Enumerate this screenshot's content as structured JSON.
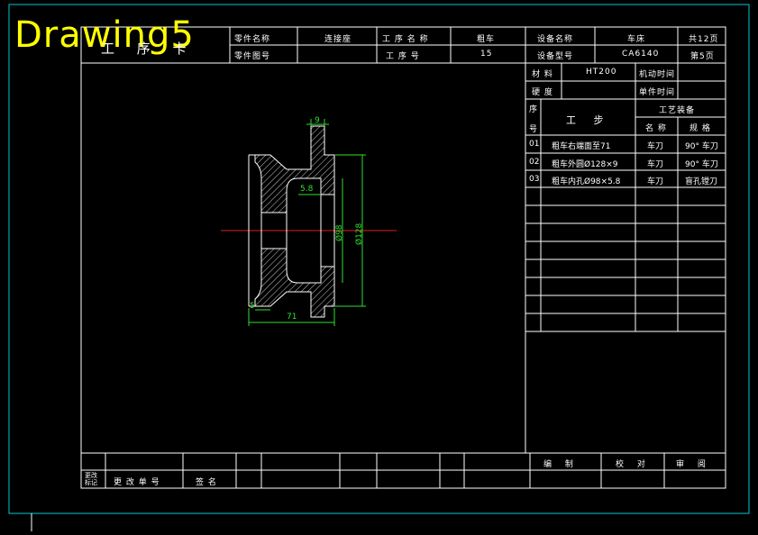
{
  "drawing_title": "Drawing5",
  "header": {
    "process_card_label": "工 序 卡",
    "part_name_label": "零件名称",
    "part_name": "连接座",
    "part_number_label": "零件图号",
    "process_name_label": "工 序 名 称",
    "process_name": "粗车",
    "process_no_label": "工 序 号",
    "process_no": "15",
    "equipment_name_label": "设备名称",
    "equipment_name": "车床",
    "equipment_model_label": "设备型号",
    "equipment_model": "CA6140",
    "total_pages": "共12页",
    "page_no": "第5页"
  },
  "material": {
    "material_label": "材 料",
    "material_value": "HT200",
    "hardness_label": "硬 度",
    "basic_time_label": "机动时间",
    "unit_time_label": "单件时间"
  },
  "steps_table": {
    "seq_label_top": "序",
    "seq_label_bottom": "号",
    "step_label": "工 步",
    "equipment_label": "工艺装备",
    "name_label": "名 称",
    "spec_label": "规 格",
    "rows": [
      {
        "no": "01",
        "step": "粗车右端面至71",
        "tool": "车刀",
        "spec": "90° 车刀"
      },
      {
        "no": "02",
        "step": "粗车外圆Ø128×9",
        "tool": "车刀",
        "spec": "90° 车刀"
      },
      {
        "no": "03",
        "step": "粗车内孔Ø98×5.8",
        "tool": "车刀",
        "spec": "盲孔镗刀"
      }
    ]
  },
  "footer": {
    "change_mark_label": "更改标记",
    "change_doc_label": "更 改 单 号",
    "signature_label": "签 名",
    "compiled_label": "编 制",
    "checked_label": "校 对",
    "approved_label": "审 阅"
  },
  "dimensions": {
    "d1": "9",
    "d2": "5.8",
    "d3": "Ø98",
    "d4": "Ø128",
    "d5": "71",
    "d6": "5"
  }
}
